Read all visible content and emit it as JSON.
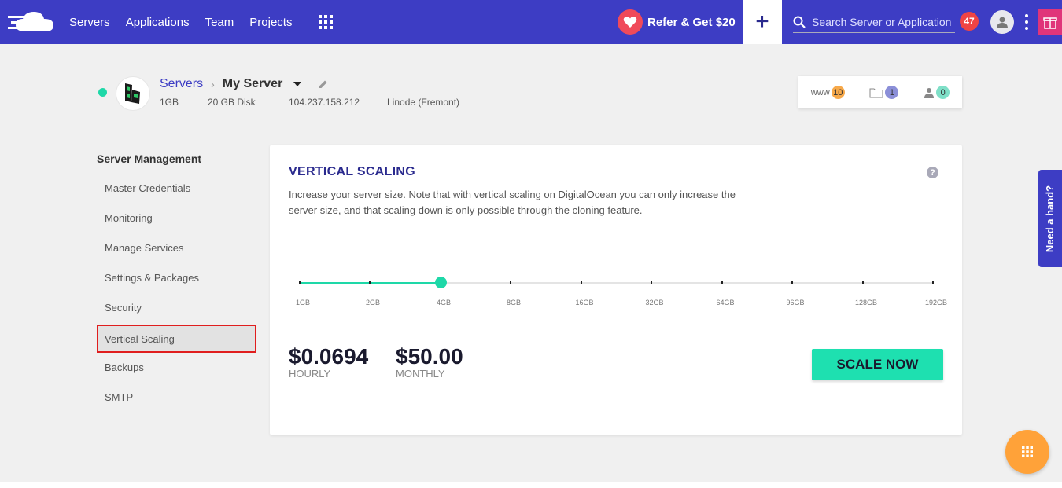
{
  "nav": {
    "items": [
      "Servers",
      "Applications",
      "Team",
      "Projects"
    ],
    "refer_label": "Refer & Get $20",
    "search_placeholder": "Search Server or Application",
    "notifications_count": "47"
  },
  "server": {
    "breadcrumb_parent": "Servers",
    "name": "My Server",
    "ram": "1GB",
    "disk": "20 GB Disk",
    "ip": "104.237.158.212",
    "provider": "Linode (Fremont)",
    "status_color": "#1ed8a8"
  },
  "stats": {
    "www_label": "www",
    "www_count": "10",
    "folders_count": "1",
    "users_count": "0"
  },
  "sidebar": {
    "title": "Server Management",
    "items": [
      {
        "label": "Master Credentials"
      },
      {
        "label": "Monitoring"
      },
      {
        "label": "Manage Services"
      },
      {
        "label": "Settings & Packages"
      },
      {
        "label": "Security"
      },
      {
        "label": "Vertical Scaling",
        "active": true
      },
      {
        "label": "Backups"
      },
      {
        "label": "SMTP"
      }
    ]
  },
  "card": {
    "title": "VERTICAL SCALING",
    "description": "Increase your server size. Note that with vertical scaling on DigitalOcean you can only increase the server size, and that scaling down is only possible through the cloning feature.",
    "slider": {
      "sizes": [
        "1GB",
        "2GB",
        "4GB",
        "8GB",
        "16GB",
        "32GB",
        "64GB",
        "96GB",
        "128GB",
        "192GB"
      ],
      "selected_index": 2
    },
    "hourly_price": "$0.0694",
    "hourly_label": "HOURLY",
    "monthly_price": "$50.00",
    "monthly_label": "MONTHLY",
    "scale_button": "SCALE NOW"
  },
  "help_tab": "Need a hand?",
  "colors": {
    "brand": "#3d3dc4",
    "accent": "#1ed8a8",
    "alert": "#ef4444",
    "fab": "#ffa239"
  }
}
